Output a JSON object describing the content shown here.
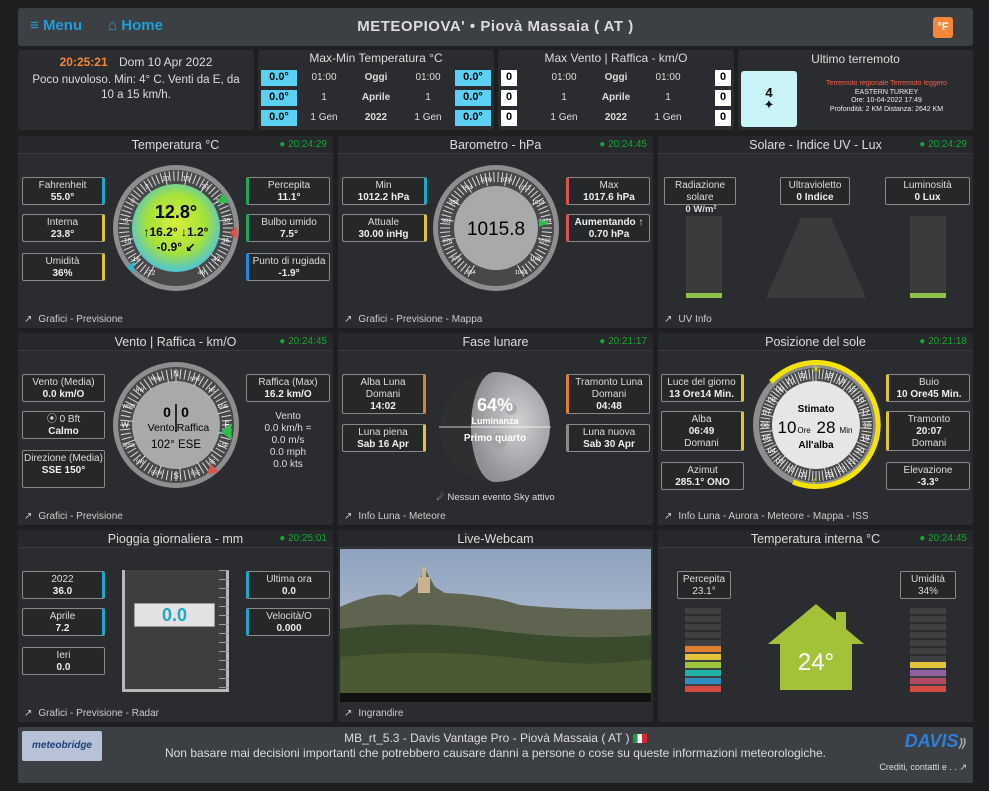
{
  "top": {
    "menu": "Menu",
    "home": "Home",
    "station": "METEOPIOVA'",
    "sep": "•",
    "place": "Piovà Massaia ( AT )",
    "unit": "°F"
  },
  "now": {
    "time": "20:25:21",
    "date": "Dom 10 Apr 2022",
    "desc": "Poco nuvoloso. Min: 4° C. Venti da E, da 10 a 15 km/h."
  },
  "minmax": {
    "title": "Max-Min Temperatura °C",
    "rows": [
      {
        "a": "0.0°",
        "t1": "01:00",
        "lbl": "Oggi",
        "t2": "01:00",
        "b": "0.0°"
      },
      {
        "a": "0.0°",
        "t1": "1",
        "lbl": "Aprile",
        "t2": "1",
        "b": "0.0°"
      },
      {
        "a": "0.0°",
        "t1": "1 Gen",
        "lbl": "2022",
        "t2": "1 Gen",
        "b": "0.0°"
      }
    ]
  },
  "maxwind": {
    "title": "Max Vento | Raffica - km/O",
    "rows": [
      {
        "a": "0",
        "t1": "01:00",
        "lbl": "Oggi",
        "t2": "01:00",
        "b": "0"
      },
      {
        "a": "0",
        "t1": "1",
        "lbl": "Aprile",
        "t2": "1",
        "b": "0"
      },
      {
        "a": "0",
        "t1": "1 Gen",
        "lbl": "2022",
        "t2": "1 Gen",
        "b": "0"
      }
    ]
  },
  "quake": {
    "title": "Ultimo terremoto",
    "mag": "4",
    "l1": "Terremoto regionale Terremoto leggero",
    "l2": "EASTERN TURKEY",
    "l3": "Ore: 10-04-2022 17:49",
    "l4": "Profondità: 2 KM Distanza: 2642 KM"
  },
  "temp": {
    "title": "Temperatura °C",
    "ts": "20:24:29",
    "fahr_l": "Fahrenheit",
    "fahr_v": "55.0°",
    "int_l": "Interna",
    "int_v": "23.8°",
    "hum_l": "Umidità",
    "hum_v": "36%",
    "perc_l": "Percepita",
    "perc_v": "11.1°",
    "bulb_l": "Bulbo umido",
    "bulb_v": "7.5°",
    "dew_l": "Punto di rugiada",
    "dew_v": "-1.9°",
    "main": "12.8°",
    "hi": "↑16.2°",
    "lo": "↓1.2°",
    "trend": "-0.9°",
    "trend_ic": "↙",
    "footer": "Grafici - Previsione",
    "ticks": [
      "-22",
      "-16",
      "-10",
      "-5",
      "0",
      "5",
      "10",
      "15",
      "20",
      "25",
      "30",
      "36",
      "42",
      "48"
    ]
  },
  "baro": {
    "title": "Barometro - hPa",
    "ts": "20:24:45",
    "min_l": "Min",
    "min_v": "1012.2 hPa",
    "act_l": "Attuale",
    "act_v": "30.00 inHg",
    "max_l": "Max",
    "max_v": "1017.6 hPa",
    "trend_l": "Aumentando ↑",
    "trend_v": "0.70 hPa",
    "main": "1015.8",
    "footer": "Grafici - Previsione - Mappa",
    "ticks": [
      "964",
      "970",
      "976",
      "982",
      "988",
      "994",
      "1000",
      "1006",
      "1012",
      "1018",
      "1024",
      "1030",
      "1036",
      "1042"
    ]
  },
  "solar": {
    "title": "Solare - Indice UV - Lux",
    "ts": "20:24:29",
    "rad_l": "Radiazione solare",
    "rad_v": "0 W/m²",
    "uv_l": "Ultravioletto",
    "uv_v": "0 Indice",
    "lux_l": "Luminosità",
    "lux_v": "0 Lux",
    "footer": "UV Info"
  },
  "wind": {
    "title": "Vento | Raffica - km/O",
    "ts": "20:24:45",
    "avg_l": "Vento (Media)",
    "avg_v": "0.0 km/O",
    "bft_l": "0 Bft",
    "bft_v": "Calmo",
    "dir_l": "Direzione (Media)",
    "dir_v": "SSE 150°",
    "gust_l": "Raffica (Max)",
    "gust_v": "16.2 km/O",
    "wl": "Vento",
    "w1": "0.0 km/h =",
    "w2": "0.0 m/s",
    "w3": "0.0 mph",
    "w4": "0.0 kts",
    "v1": "0",
    "v2": "0",
    "lbl1": "Vento",
    "lbl2": "Raffica",
    "dir": "102° ESE",
    "footer": "Grafici - Previsione",
    "dirs": [
      "N",
      "NNE",
      "NE",
      "ENE",
      "E",
      "ESE",
      "SE",
      "SSE",
      "S",
      "SSW",
      "SW",
      "WSW",
      "W",
      "WNW",
      "NW",
      "NNW"
    ]
  },
  "moon": {
    "title": "Fase lunare",
    "ts": "20:21:17",
    "rise_l": "Alba Luna Domani",
    "rise_v": "14:02",
    "full_l": "Luna piena",
    "full_v": "Sab 16 Apr",
    "set_l": "Tramonto Luna Domani",
    "set_v": "04:48",
    "new_l": "Luna nuova",
    "new_v": "Sab 30 Apr",
    "pct": "64%",
    "lum": "Luminanza",
    "phase": "Primo quarto",
    "sky": "Nessun evento Sky attivo",
    "footer": "Info Luna - Meteore"
  },
  "sun": {
    "title": "Posizione del sole",
    "ts": "20:21:18",
    "day_l": "Luce del giorno",
    "day_v": "13 Ore14 Min.",
    "rise_l": "Alba",
    "rise_v": "06:49",
    "rise_d": "Domani",
    "az_l": "Azimut",
    "az_v": "285.1° ONO",
    "dark_l": "Buio",
    "dark_v": "10 Ore45 Min.",
    "set_l": "Tramonto",
    "set_v": "20:07",
    "set_d": "Domani",
    "el_l": "Elevazione",
    "el_v": "-3.3°",
    "est": "Stimato",
    "h": "10",
    "ore": "Ore",
    "m": "28",
    "min": "Min",
    "dawn": "All'alba",
    "footer": "Info Luna - Aurora - Meteore - Mappa - ISS"
  },
  "rain": {
    "title": "Pioggia giornaliera - mm",
    "ts": "20:25:01",
    "y_l": "2022",
    "y_v": "36.0",
    "m_l": "Aprile",
    "m_v": "7.2",
    "d_l": "Ieri",
    "d_v": "0.0",
    "h_l": "Ultima ora",
    "h_v": "0.0",
    "r_l": "Velocità/O",
    "r_v": "0.000",
    "main": "0.0",
    "footer": "Grafici - Previsione - Radar"
  },
  "cam": {
    "title": "Live-Webcam",
    "footer": "Ingrandire"
  },
  "indoor": {
    "title": "Temperatura interna °C",
    "ts": "20:24:45",
    "perc_l": "Percepita",
    "perc_v": "23.1°",
    "hum_l": "Umidità",
    "hum_v": "34%",
    "main": "24°"
  },
  "foot": {
    "logo": "meteobridge",
    "line1": "MB_rt_5.3  -  Davis Vantage Pro  -  Piovà Massaia ( AT )",
    "line2": "Non basare mai decisioni importanti che potrebbero causare danni a persone o cose su queste informazioni meteorologiche.",
    "brand": "DAVIS",
    "credits": "Crediti, contatti e . ."
  }
}
